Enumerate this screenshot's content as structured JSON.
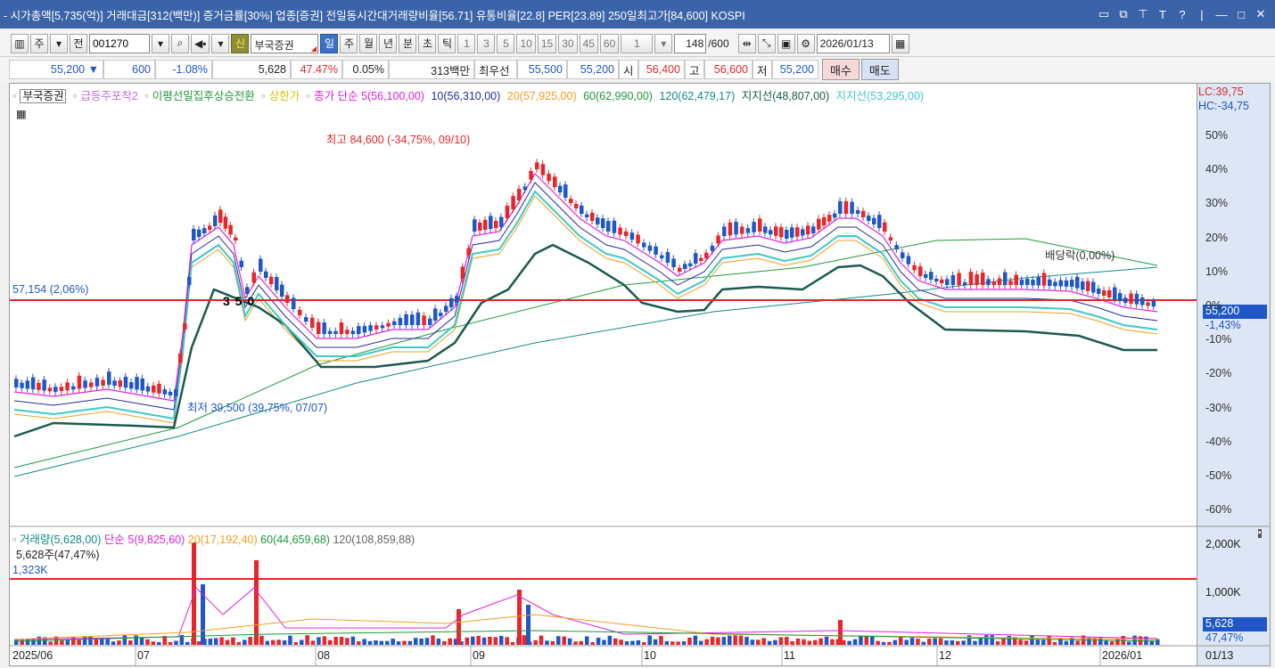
{
  "window": {
    "title": "- 시가총액[5,735(억)] 거래대금[312(백만)] 증거금률[30%] 업종[증권] 전일동시간대거래량비율[56.71] 유통비율[22.8] PER[23.89] 250일최고가[84,600] KOSPI",
    "buttons": [
      "▭",
      "⧉",
      "⊤",
      "T",
      "?",
      "|",
      "—",
      "□",
      "✕"
    ]
  },
  "toolbar": {
    "period_label": "주",
    "prev_label": "전",
    "code": "001270",
    "new_badge": "신",
    "stock_name": "부국증권",
    "periods": [
      "일",
      "주",
      "월",
      "년",
      "분",
      "초",
      "틱"
    ],
    "minutes": [
      "1",
      "3",
      "5",
      "10",
      "15",
      "30",
      "45",
      "60"
    ],
    "unit_value": "1",
    "count": "148",
    "count_total": "/600",
    "date": "2026/01/13"
  },
  "quote": {
    "price": "55,200",
    "change": "600",
    "change_pct": "-1.08%",
    "volume": "5,628",
    "vol_ratio": "47.47%",
    "turnover": "0.05%",
    "amount": "313백만",
    "best_label": "최우선",
    "ask": "55,500",
    "bid": "55,200",
    "open_label": "시",
    "open": "56,400",
    "high_label": "고",
    "high": "56,600",
    "low_label": "저",
    "low": "55,200",
    "buy": "매수",
    "sell": "매도"
  },
  "legend": {
    "name": "부국증권",
    "i1": "급등주포착2",
    "i2": "이평선밀집후상승전환",
    "i3": "상한가",
    "i4": "종가 단순 5(56,100,00)",
    "ma10": "10(56,310,00)",
    "ma20": "20(57,925,00)",
    "ma60": "60(62,990,00)",
    "ma120": "120(62,479,17)",
    "support": "지지선(48,807,00)",
    "support2": "지지선(53,295,00)"
  },
  "chart_labels": {
    "lc": "LC:39,75",
    "hc": "HC:-34,75",
    "high_ann": "최고 84,600 (-34,75%, 09/10)",
    "low_ann": "최저 39,500 (39,75%, 07/07)",
    "ref_line": "57,154 (2,06%)",
    "dividend": "배당락(0,00%)",
    "price_tag": "55,200",
    "price_pct": "-1,43%",
    "hand": "3 5 0"
  },
  "price_axis": [
    "50%",
    "40%",
    "30%",
    "20%",
    "10%",
    "0%",
    "-10%",
    "-20%",
    "-30%",
    "-40%",
    "-50%",
    "-60%"
  ],
  "vol_legend": {
    "vol": "거래량(5,628,00)",
    "ma5": "단순 5(9,825,60)",
    "ma20": "20(17,192,40)",
    "ma60": "60(44,659,68)",
    "ma120": "120(108,859,88)",
    "shares": "5,628주(47,47%)",
    "ref": "1,323K"
  },
  "vol_axis": [
    "2,000K",
    "1,000K"
  ],
  "vol_tag": "5,628",
  "vol_pct": "47,47%",
  "x_axis": [
    "2025/06",
    "07",
    "08",
    "09",
    "10",
    "11",
    "12",
    "2026/01",
    "01/13"
  ],
  "colors": {
    "up": "#e8262a",
    "down": "#1f57c9",
    "ma5": "#e020e0",
    "ma10": "#2a2aa0",
    "ma20": "#f0a020",
    "ma60": "#1d9a3a",
    "ma120": "#138a8a",
    "support": "#1a5a50",
    "support2": "#40c8c8",
    "ref": "#e8262a"
  }
}
